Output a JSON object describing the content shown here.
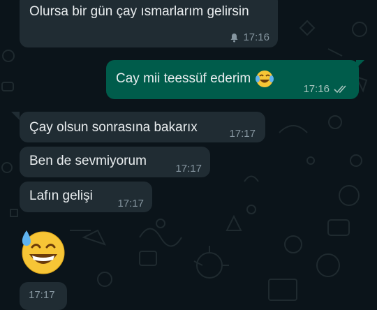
{
  "messages": [
    {
      "direction": "in",
      "text": "Olursa bir gün çay ısmarlarım gelirsin",
      "time": "17:16",
      "status_icon": "bell-muted-icon"
    },
    {
      "direction": "out",
      "text": "Cay mii teessüf ederim",
      "emoji": "face-with-tears-of-joy",
      "time": "17:16",
      "status_icon": "double-check-icon"
    },
    {
      "direction": "in",
      "text": "Çay olsun sonrasına bakarıx",
      "time": "17:17"
    },
    {
      "direction": "in",
      "text": "Ben de sevmiyorum",
      "time": "17:17"
    },
    {
      "direction": "in",
      "text": "Lafın gelişi",
      "time": "17:17"
    },
    {
      "direction": "in",
      "emoji": "grinning-face-with-sweat",
      "time": "17:17"
    }
  ],
  "colors": {
    "background": "#0b141a",
    "incoming_bubble": "#202c33",
    "outgoing_bubble": "#005c4b",
    "text": "#e9edef",
    "meta_text": "#8696a0"
  }
}
